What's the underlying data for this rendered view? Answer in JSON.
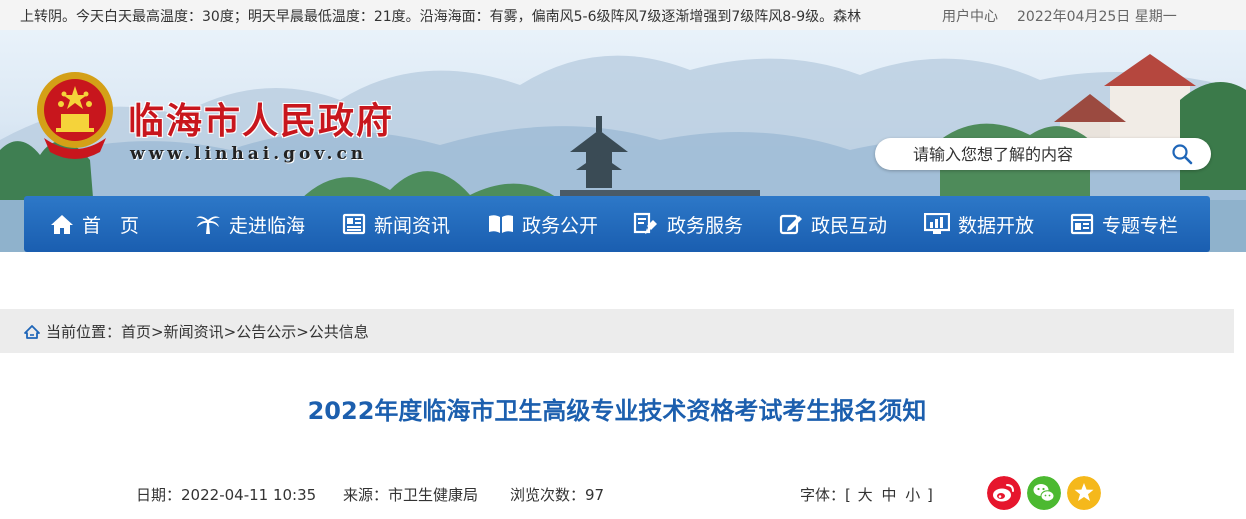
{
  "topbar": {
    "weather": "上转阴。今天白天最高温度：30度；明天早晨最低温度：21度。沿海海面：有雾，偏南风5-6级阵风7级逐渐增强到7级阵风8-9级。森林",
    "user_center": "用户中心",
    "date": "2022年04月25日 星期一"
  },
  "header": {
    "site_title": "临海市人民政府",
    "site_url": "www.linhai.gov.cn",
    "search_placeholder": "请输入您想了解的内容",
    "search_icon": "magnifier-icon"
  },
  "nav": [
    {
      "label": "首　页",
      "icon": "home-icon"
    },
    {
      "label": "走进临海",
      "icon": "palm-tree-icon"
    },
    {
      "label": "新闻资讯",
      "icon": "newspaper-icon"
    },
    {
      "label": "政务公开",
      "icon": "open-book-icon"
    },
    {
      "label": "政务服务",
      "icon": "service-icon"
    },
    {
      "label": "政民互动",
      "icon": "edit-icon"
    },
    {
      "label": "数据开放",
      "icon": "monitor-chart-icon"
    },
    {
      "label": "专题专栏",
      "icon": "window-icon"
    }
  ],
  "breadcrumb": {
    "label": "当前位置：",
    "items": [
      "首页",
      "新闻资讯",
      "公告公示",
      "公共信息"
    ],
    "separator": ">"
  },
  "article": {
    "title": "2022年度临海市卫生高级专业技术资格考试考生报名须知",
    "date_label": "日期：",
    "date_value": "2022-04-11 10:35",
    "source_label": "来源：",
    "source_value": "市卫生健康局",
    "views_label": "浏览次数：",
    "views_value": "97",
    "font_label": "字体：",
    "font_open": "[",
    "font_large": "大",
    "font_medium": "中",
    "font_small": "小",
    "font_close": "]"
  },
  "share": [
    {
      "name": "weibo",
      "color": "#e6162d"
    },
    {
      "name": "wechat",
      "color": "#4cb931"
    },
    {
      "name": "favorite",
      "color": "#f5b81b"
    }
  ],
  "colors": {
    "nav_bg": "#1f66b8",
    "title_blue": "#1c5fae",
    "site_red": "#c8161d"
  }
}
